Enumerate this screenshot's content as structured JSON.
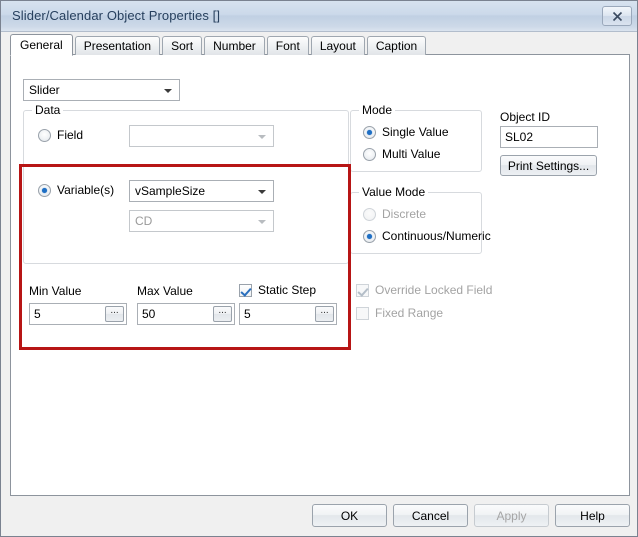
{
  "window": {
    "title": "Slider/Calendar Object Properties []",
    "close_icon": "close-icon"
  },
  "tabs": [
    {
      "label": "General",
      "active": true
    },
    {
      "label": "Presentation",
      "active": false
    },
    {
      "label": "Sort",
      "active": false
    },
    {
      "label": "Number",
      "active": false
    },
    {
      "label": "Font",
      "active": false
    },
    {
      "label": "Layout",
      "active": false
    },
    {
      "label": "Caption",
      "active": false
    }
  ],
  "object_type_combo": {
    "value": "Slider"
  },
  "data_group": {
    "title": "Data",
    "field_radio": {
      "label": "Field",
      "checked": false
    },
    "field_combo": {
      "value": "",
      "disabled": true
    },
    "variables_radio": {
      "label": "Variable(s)",
      "checked": true
    },
    "variables_combo": {
      "value": "vSampleSize",
      "disabled": false
    },
    "secondary_combo": {
      "value": "CD",
      "disabled": true
    },
    "min_value": {
      "label": "Min Value",
      "value": "5",
      "browse": "..."
    },
    "max_value": {
      "label": "Max Value",
      "value": "50",
      "browse": "..."
    },
    "static_step": {
      "label": "Static Step",
      "checked": true,
      "value": "5",
      "browse": "..."
    }
  },
  "mode_group": {
    "title": "Mode",
    "options": [
      {
        "label": "Single Value",
        "checked": true,
        "disabled": false
      },
      {
        "label": "Multi Value",
        "checked": false,
        "disabled": false
      }
    ]
  },
  "value_mode_group": {
    "title": "Value Mode",
    "options": [
      {
        "label": "Discrete",
        "checked": false,
        "disabled": true
      },
      {
        "label": "Continuous/Numeric",
        "checked": true,
        "disabled": false
      }
    ]
  },
  "extra_checkboxes": [
    {
      "label": "Override Locked Field",
      "checked": true,
      "disabled": true
    },
    {
      "label": "Fixed Range",
      "checked": false,
      "disabled": true
    }
  ],
  "object_id": {
    "label": "Object ID",
    "value": "SL02"
  },
  "print_settings_button": {
    "label": "Print Settings..."
  },
  "footer": {
    "ok": "OK",
    "cancel": "Cancel",
    "apply": "Apply",
    "help": "Help"
  },
  "colors": {
    "highlight": "#b71515",
    "accent": "#1f6fc4",
    "title_text": "#27405e"
  }
}
